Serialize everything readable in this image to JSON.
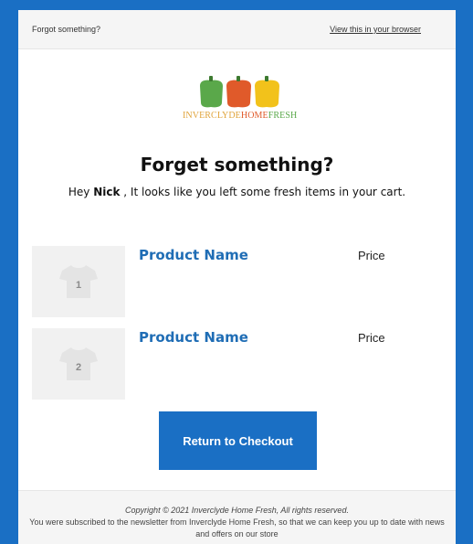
{
  "preheader": {
    "left_text": "Forgot something?",
    "view_link": "View this in your browser"
  },
  "logo": {
    "word1": "INVERCLYDE",
    "word2": "HOME",
    "word3": "FRESH",
    "icon": "bell-peppers-logo",
    "colors": {
      "green": "#5aa84a",
      "red": "#e05a2a",
      "yellow": "#f2c21b"
    }
  },
  "main": {
    "title": "Forget something?",
    "greeting_prefix": "Hey",
    "customer_name": "Nick",
    "greeting_suffix": ", It looks like you left some fresh items in your",
    "greeting_end": "cart."
  },
  "products": [
    {
      "name": "Product Name",
      "price_label": "Price",
      "thumb_number": "1",
      "icon": "tshirt-icon"
    },
    {
      "name": "Product Name",
      "price_label": "Price",
      "thumb_number": "2",
      "icon": "tshirt-icon"
    }
  ],
  "cta": {
    "label": "Return to Checkout"
  },
  "footer": {
    "copyright": "Copyright © 2021 Inverclyde Home Fresh, All rights reserved.",
    "subscription": "You were subscribed to the newsletter from Inverclyde Home Fresh, so that we can keep you up to date with news and offers on our store"
  },
  "colors": {
    "accent": "#1a6fc4",
    "product_name": "#1f6db5"
  }
}
